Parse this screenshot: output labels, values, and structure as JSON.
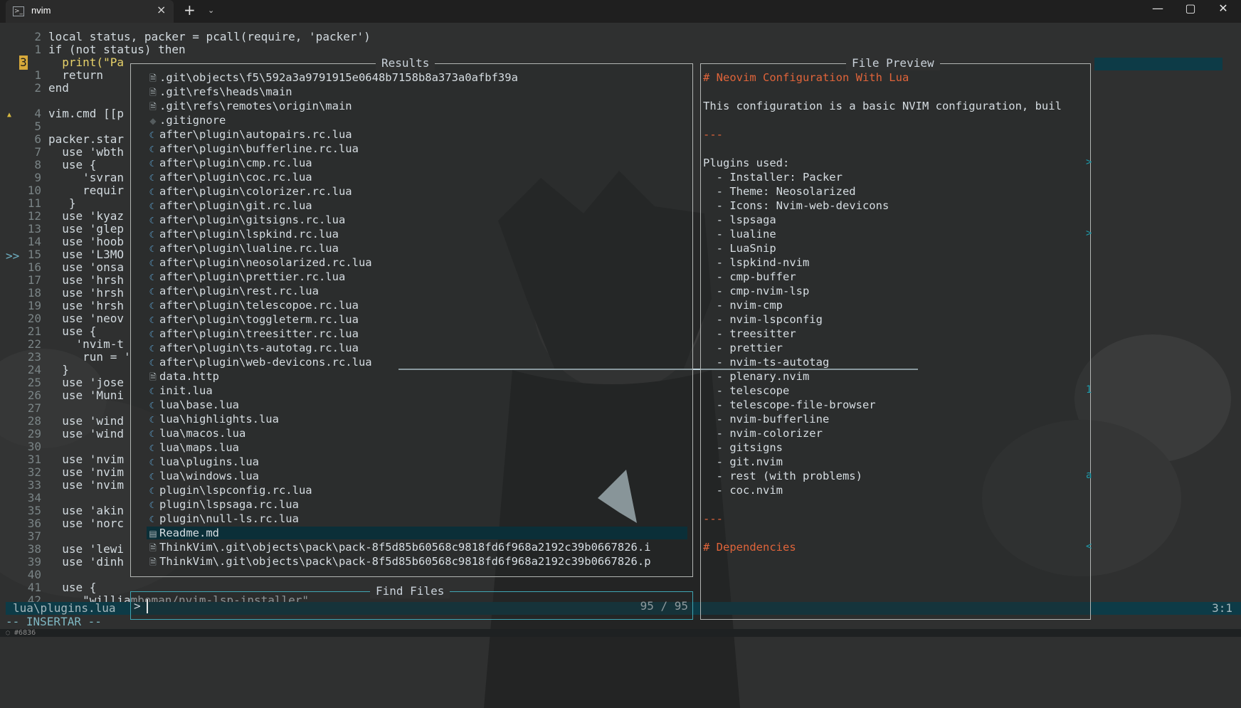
{
  "window": {
    "tab_icon": "terminal-icon",
    "tab_title": "nvim",
    "tab_close": "×",
    "new_tab": "+",
    "tab_menu": "⌄",
    "minimize": "—",
    "maximize": "▢",
    "close": "✕"
  },
  "editor": {
    "line_numbers": [
      "2",
      "1",
      "3",
      "1",
      "2",
      "",
      "4",
      "5",
      "6",
      "7",
      "8",
      "9",
      "10",
      "11",
      "12",
      "13",
      "14",
      "15",
      "16",
      "17",
      "18",
      "19",
      "20",
      "21",
      "22",
      "23",
      "24",
      "25",
      "26",
      "27",
      "28",
      "29",
      "30",
      "31",
      "32",
      "33",
      "34",
      "35",
      "36",
      "37",
      "38",
      "39",
      "40",
      "41",
      "42"
    ],
    "current_line_marker": ">>",
    "sign_warning": "▲",
    "code_lines": [
      "local status, packer = pcall(require, 'packer')",
      "if (not status) then",
      "  print(\"Pa",
      "  return",
      "end",
      "",
      "vim.cmd [[p",
      "",
      "packer.star",
      "  use 'wbth",
      "  use {",
      "     'svran",
      "     requir",
      "   }",
      "  use 'kyaz",
      "  use 'glep",
      "  use 'hoob",
      "  use 'L3MO",
      "  use 'onsa",
      "  use 'hrsh",
      "  use 'hrsh",
      "  use 'hrsh",
      "  use 'neov",
      "  use {",
      "    'nvim-t",
      "     run = '",
      "  }",
      "  use 'jose",
      "  use 'Muni",
      "",
      "  use 'wind",
      "  use 'wind",
      "",
      "  use 'nvim",
      "  use 'nvim",
      "  use 'nvim",
      "",
      "  use 'akin",
      "  use 'norc",
      "",
      "  use 'lewi",
      "  use 'dinh",
      "",
      "  use {",
      "     \"williamboman/nvim-lsp-installer\","
    ]
  },
  "results": {
    "title": "Results",
    "items": [
      {
        "icon": "file-icon",
        "glyph": "🗎",
        "text": ".git\\objects\\f5\\592a3a9791915e0648b7158b8a373a0afbf39a"
      },
      {
        "icon": "file-icon",
        "glyph": "🗎",
        "text": ".git\\refs\\heads\\main"
      },
      {
        "icon": "file-icon",
        "glyph": "🗎",
        "text": ".git\\refs\\remotes\\origin\\main"
      },
      {
        "icon": "git-icon",
        "glyph": "◆",
        "text": ".gitignore"
      },
      {
        "icon": "lua-icon",
        "glyph": "☾",
        "text": "after\\plugin\\autopairs.rc.lua"
      },
      {
        "icon": "lua-icon",
        "glyph": "☾",
        "text": "after\\plugin\\bufferline.rc.lua"
      },
      {
        "icon": "lua-icon",
        "glyph": "☾",
        "text": "after\\plugin\\cmp.rc.lua"
      },
      {
        "icon": "lua-icon",
        "glyph": "☾",
        "text": "after\\plugin\\coc.rc.lua"
      },
      {
        "icon": "lua-icon",
        "glyph": "☾",
        "text": "after\\plugin\\colorizer.rc.lua"
      },
      {
        "icon": "lua-icon",
        "glyph": "☾",
        "text": "after\\plugin\\git.rc.lua"
      },
      {
        "icon": "lua-icon",
        "glyph": "☾",
        "text": "after\\plugin\\gitsigns.rc.lua"
      },
      {
        "icon": "lua-icon",
        "glyph": "☾",
        "text": "after\\plugin\\lspkind.rc.lua"
      },
      {
        "icon": "lua-icon",
        "glyph": "☾",
        "text": "after\\plugin\\lualine.rc.lua"
      },
      {
        "icon": "lua-icon",
        "glyph": "☾",
        "text": "after\\plugin\\neosolarized.rc.lua"
      },
      {
        "icon": "lua-icon",
        "glyph": "☾",
        "text": "after\\plugin\\prettier.rc.lua"
      },
      {
        "icon": "lua-icon",
        "glyph": "☾",
        "text": "after\\plugin\\rest.rc.lua"
      },
      {
        "icon": "lua-icon",
        "glyph": "☾",
        "text": "after\\plugin\\telescopoe.rc.lua"
      },
      {
        "icon": "lua-icon",
        "glyph": "☾",
        "text": "after\\plugin\\toggleterm.rc.lua"
      },
      {
        "icon": "lua-icon",
        "glyph": "☾",
        "text": "after\\plugin\\treesitter.rc.lua"
      },
      {
        "icon": "lua-icon",
        "glyph": "☾",
        "text": "after\\plugin\\ts-autotag.rc.lua"
      },
      {
        "icon": "lua-icon",
        "glyph": "☾",
        "text": "after\\plugin\\web-devicons.rc.lua"
      },
      {
        "icon": "file-icon",
        "glyph": "🗎",
        "text": "data.http"
      },
      {
        "icon": "lua-icon",
        "glyph": "☾",
        "text": "init.lua"
      },
      {
        "icon": "lua-icon",
        "glyph": "☾",
        "text": "lua\\base.lua"
      },
      {
        "icon": "lua-icon",
        "glyph": "☾",
        "text": "lua\\highlights.lua"
      },
      {
        "icon": "lua-icon",
        "glyph": "☾",
        "text": "lua\\macos.lua"
      },
      {
        "icon": "lua-icon",
        "glyph": "☾",
        "text": "lua\\maps.lua"
      },
      {
        "icon": "lua-icon",
        "glyph": "☾",
        "text": "lua\\plugins.lua"
      },
      {
        "icon": "lua-icon",
        "glyph": "☾",
        "text": "lua\\windows.lua"
      },
      {
        "icon": "lua-icon",
        "glyph": "☾",
        "text": "plugin\\lspconfig.rc.lua"
      },
      {
        "icon": "lua-icon",
        "glyph": "☾",
        "text": "plugin\\lspsaga.rc.lua"
      },
      {
        "icon": "lua-icon",
        "glyph": "☾",
        "text": "plugin\\null-ls.rc.lua"
      },
      {
        "icon": "markdown-icon",
        "glyph": "▤",
        "text": "Readme.md",
        "selected": true
      },
      {
        "icon": "file-icon",
        "glyph": "🗎",
        "text": "ThinkVim\\.git\\objects\\pack\\pack-8f5d85b60568c9818fd6f968a2192c39b0667826.i"
      },
      {
        "icon": "file-icon",
        "glyph": "🗎",
        "text": "ThinkVim\\.git\\objects\\pack\\pack-8f5d85b60568c9818fd6f968a2192c39b0667826.p"
      }
    ]
  },
  "preview": {
    "title": "File Preview",
    "lines": [
      {
        "text": "# Neovim Configuration With Lua",
        "style": "heading"
      },
      {
        "text": "",
        "style": "normal"
      },
      {
        "text": "This configuration is a basic NVIM configuration, buil",
        "style": "normal"
      },
      {
        "text": "",
        "style": "normal"
      },
      {
        "text": "---",
        "style": "heading"
      },
      {
        "text": "",
        "style": "normal"
      },
      {
        "text": "Plugins used:",
        "style": "normal"
      },
      {
        "text": "  - Installer: Packer",
        "style": "normal"
      },
      {
        "text": "  - Theme: Neosolarized",
        "style": "normal"
      },
      {
        "text": "  - Icons: Nvim-web-devicons",
        "style": "normal"
      },
      {
        "text": "  - lspsaga",
        "style": "normal"
      },
      {
        "text": "  - lualine",
        "style": "normal"
      },
      {
        "text": "  - LuaSnip",
        "style": "normal"
      },
      {
        "text": "  - lspkind-nvim",
        "style": "normal"
      },
      {
        "text": "  - cmp-buffer",
        "style": "normal"
      },
      {
        "text": "  - cmp-nvim-lsp",
        "style": "normal"
      },
      {
        "text": "  - nvim-cmp",
        "style": "normal"
      },
      {
        "text": "  - nvim-lspconfig",
        "style": "normal"
      },
      {
        "text": "  - treesitter",
        "style": "normal"
      },
      {
        "text": "  - prettier",
        "style": "normal"
      },
      {
        "text": "  - nvim-ts-autotag",
        "style": "normal"
      },
      {
        "text": "  - plenary.nvim",
        "style": "normal"
      },
      {
        "text": "  - telescope",
        "style": "normal"
      },
      {
        "text": "  - telescope-file-browser",
        "style": "normal"
      },
      {
        "text": "  - nvim-bufferline",
        "style": "normal"
      },
      {
        "text": "  - nvim-colorizer",
        "style": "normal"
      },
      {
        "text": "  - gitsigns",
        "style": "normal"
      },
      {
        "text": "  - git.nvim",
        "style": "normal"
      },
      {
        "text": "  - rest (with problems)",
        "style": "normal"
      },
      {
        "text": "  - coc.nvim",
        "style": "normal"
      },
      {
        "text": "",
        "style": "normal"
      },
      {
        "text": "---",
        "style": "heading"
      },
      {
        "text": "",
        "style": "normal"
      },
      {
        "text": "# Dependencies",
        "style": "heading"
      }
    ],
    "side_markers": [
      ">",
      ">",
      "1",
      "a",
      "<"
    ]
  },
  "prompt": {
    "title": "Find Files",
    "prefix": ">",
    "value": "",
    "counter": "95 / 95"
  },
  "statusline": {
    "file": "lua\\plugins.lua",
    "position": "3:1"
  },
  "mode": "-- INSERTAR --",
  "bottom_text": "◌ #6836",
  "colors": {
    "accent": "#0d3b47",
    "keyword": "#d8473d",
    "heading": "#e0643a",
    "selection": "#0b2f38"
  }
}
